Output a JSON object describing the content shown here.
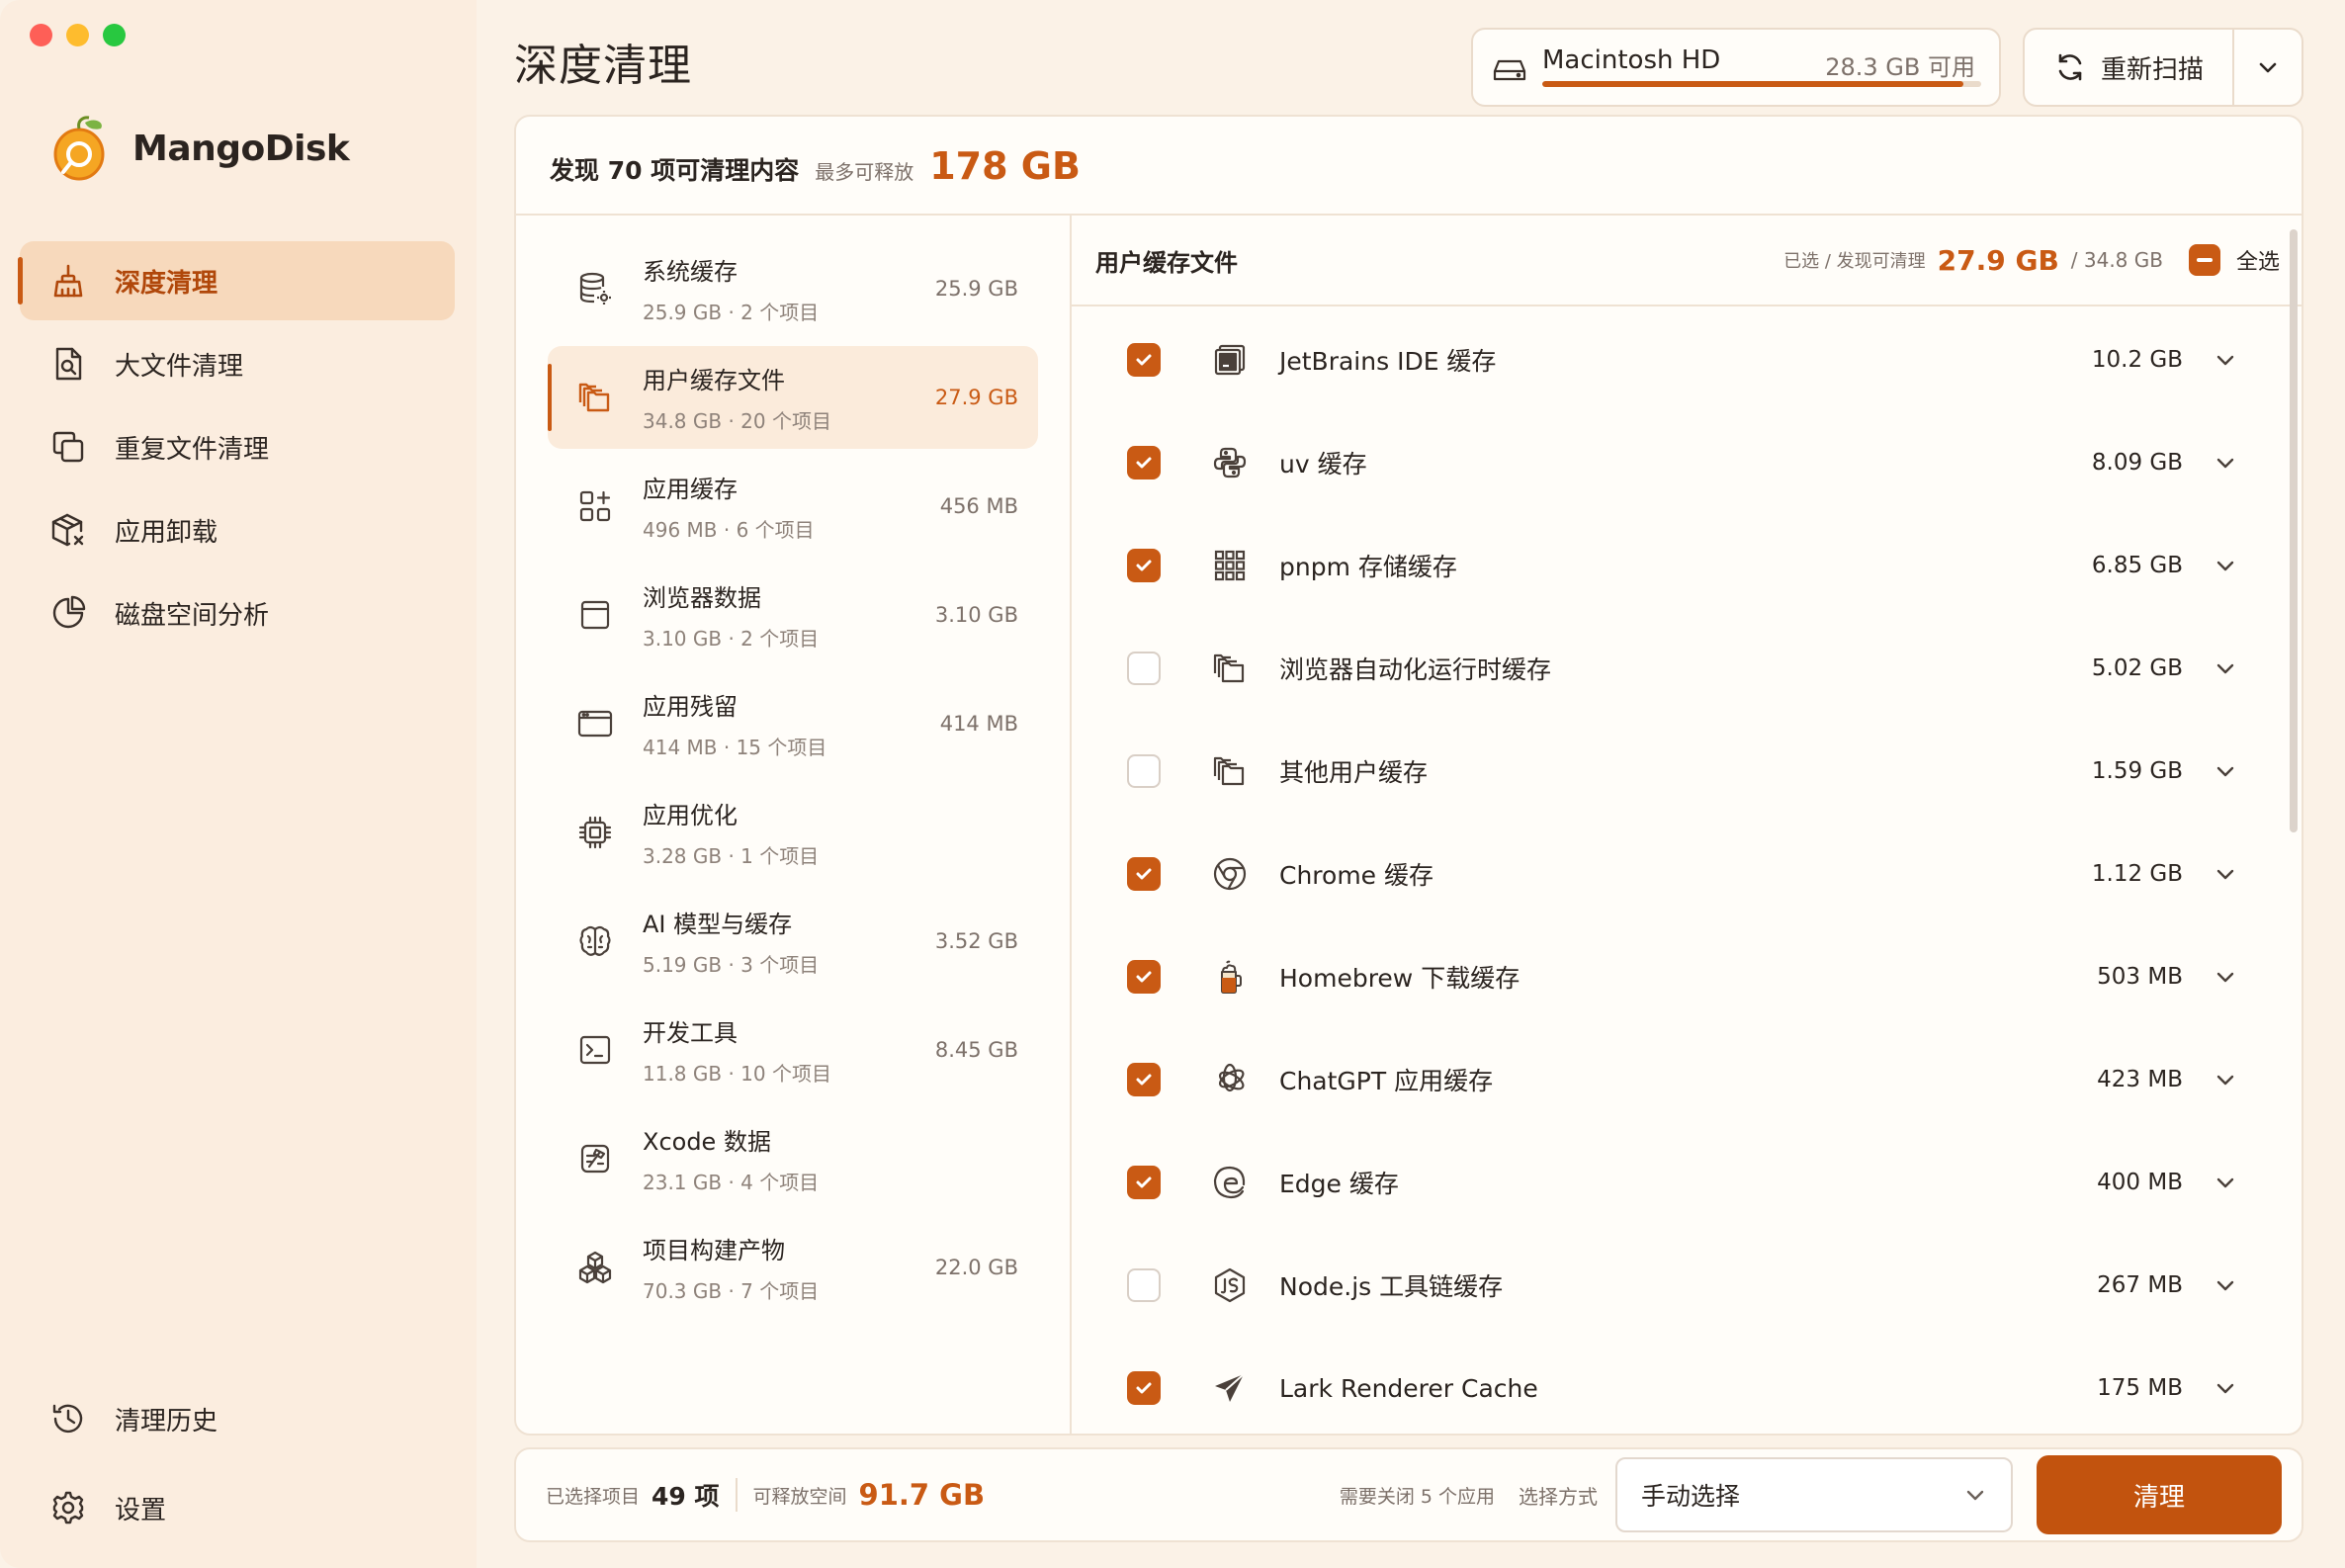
{
  "app": {
    "name": "MangoDisk"
  },
  "colors": {
    "accent": "#C95A14",
    "sidebar_bg": "#FBEDDF",
    "window_bg": "#FBF2E7",
    "card_bg": "#FFFDF9"
  },
  "sidebar": {
    "items": [
      {
        "label": "深度清理",
        "icon": "broom-icon",
        "active": true
      },
      {
        "label": "大文件清理",
        "icon": "file-search-icon",
        "active": false
      },
      {
        "label": "重复文件清理",
        "icon": "duplicate-icon",
        "active": false
      },
      {
        "label": "应用卸载",
        "icon": "package-remove-icon",
        "active": false
      },
      {
        "label": "磁盘空间分析",
        "icon": "pie-chart-icon",
        "active": false
      }
    ],
    "bottom_items": [
      {
        "label": "清理历史",
        "icon": "history-icon"
      },
      {
        "label": "设置",
        "icon": "gear-icon"
      }
    ]
  },
  "header": {
    "title": "深度清理",
    "disk": {
      "name": "Macintosh HD",
      "free": "28.3 GB 可用",
      "used_fraction": 0.96
    },
    "rescan_label": "重新扫描"
  },
  "summary": {
    "found": "发现 70 项可清理内容",
    "max_label": "最多可释放",
    "max_size": "178 GB"
  },
  "categories": [
    {
      "name": "系统缓存",
      "meta": "25.9 GB · 2 个项目",
      "size": "25.9 GB",
      "icon": "database-gear-icon",
      "active": false
    },
    {
      "name": "用户缓存文件",
      "meta": "34.8 GB · 20 个项目",
      "size": "27.9 GB",
      "icon": "stacked-folders-icon",
      "active": true
    },
    {
      "name": "应用缓存",
      "meta": "496 MB · 6 个项目",
      "size": "456 MB",
      "icon": "app-grid-plus-icon",
      "active": false
    },
    {
      "name": "浏览器数据",
      "meta": "3.10 GB · 2 个项目",
      "size": "3.10 GB",
      "icon": "browser-window-icon",
      "active": false
    },
    {
      "name": "应用残留",
      "meta": "414 MB · 15 个项目",
      "size": "414 MB",
      "icon": "app-window-icon",
      "active": false
    },
    {
      "name": "应用优化",
      "meta": "3.28 GB · 1 个项目",
      "size": "",
      "icon": "cpu-chip-icon",
      "active": false
    },
    {
      "name": "AI 模型与缓存",
      "meta": "5.19 GB · 3 个项目",
      "size": "3.52 GB",
      "icon": "brain-icon",
      "active": false
    },
    {
      "name": "开发工具",
      "meta": "11.8 GB · 10 个项目",
      "size": "8.45 GB",
      "icon": "terminal-icon",
      "active": false
    },
    {
      "name": "Xcode 数据",
      "meta": "23.1 GB · 4 个项目",
      "size": "",
      "icon": "xcode-hammer-icon",
      "active": false
    },
    {
      "name": "项目构建产物",
      "meta": "70.3 GB · 7 个项目",
      "size": "22.0 GB",
      "icon": "cubes-icon",
      "active": false
    }
  ],
  "detail": {
    "title": "用户缓存文件",
    "selected_label": "已选 / 发现可清理",
    "selected_size": "27.9 GB",
    "total": "/ 34.8 GB",
    "select_all_label": "全选",
    "rows": [
      {
        "name": "JetBrains IDE 缓存",
        "size": "10.2 GB",
        "checked": true,
        "icon": "jetbrains-icon"
      },
      {
        "name": "uv 缓存",
        "size": "8.09 GB",
        "checked": true,
        "icon": "python-icon"
      },
      {
        "name": "pnpm 存储缓存",
        "size": "6.85 GB",
        "checked": true,
        "icon": "pnpm-grid-icon"
      },
      {
        "name": "浏览器自动化运行时缓存",
        "size": "5.02 GB",
        "checked": false,
        "icon": "stacked-folders-icon"
      },
      {
        "name": "其他用户缓存",
        "size": "1.59 GB",
        "checked": false,
        "icon": "stacked-folders-icon"
      },
      {
        "name": "Chrome 缓存",
        "size": "1.12 GB",
        "checked": true,
        "icon": "chrome-icon"
      },
      {
        "name": "Homebrew 下载缓存",
        "size": "503 MB",
        "checked": true,
        "icon": "homebrew-icon"
      },
      {
        "name": "ChatGPT 应用缓存",
        "size": "423 MB",
        "checked": true,
        "icon": "chatgpt-icon"
      },
      {
        "name": "Edge 缓存",
        "size": "400 MB",
        "checked": true,
        "icon": "edge-icon"
      },
      {
        "name": "Node.js 工具链缓存",
        "size": "267 MB",
        "checked": false,
        "icon": "nodejs-icon"
      },
      {
        "name": "Lark Renderer Cache",
        "size": "175 MB",
        "checked": true,
        "icon": "lark-plane-icon"
      }
    ]
  },
  "footer": {
    "selected_label": "已选择项目",
    "selected_count": "49 项",
    "space_label": "可释放空间",
    "space_size": "91.7 GB",
    "need_close": "需要关闭 5 个应用",
    "mode_label": "选择方式",
    "mode_value": "手动选择",
    "clean_label": "清理"
  }
}
